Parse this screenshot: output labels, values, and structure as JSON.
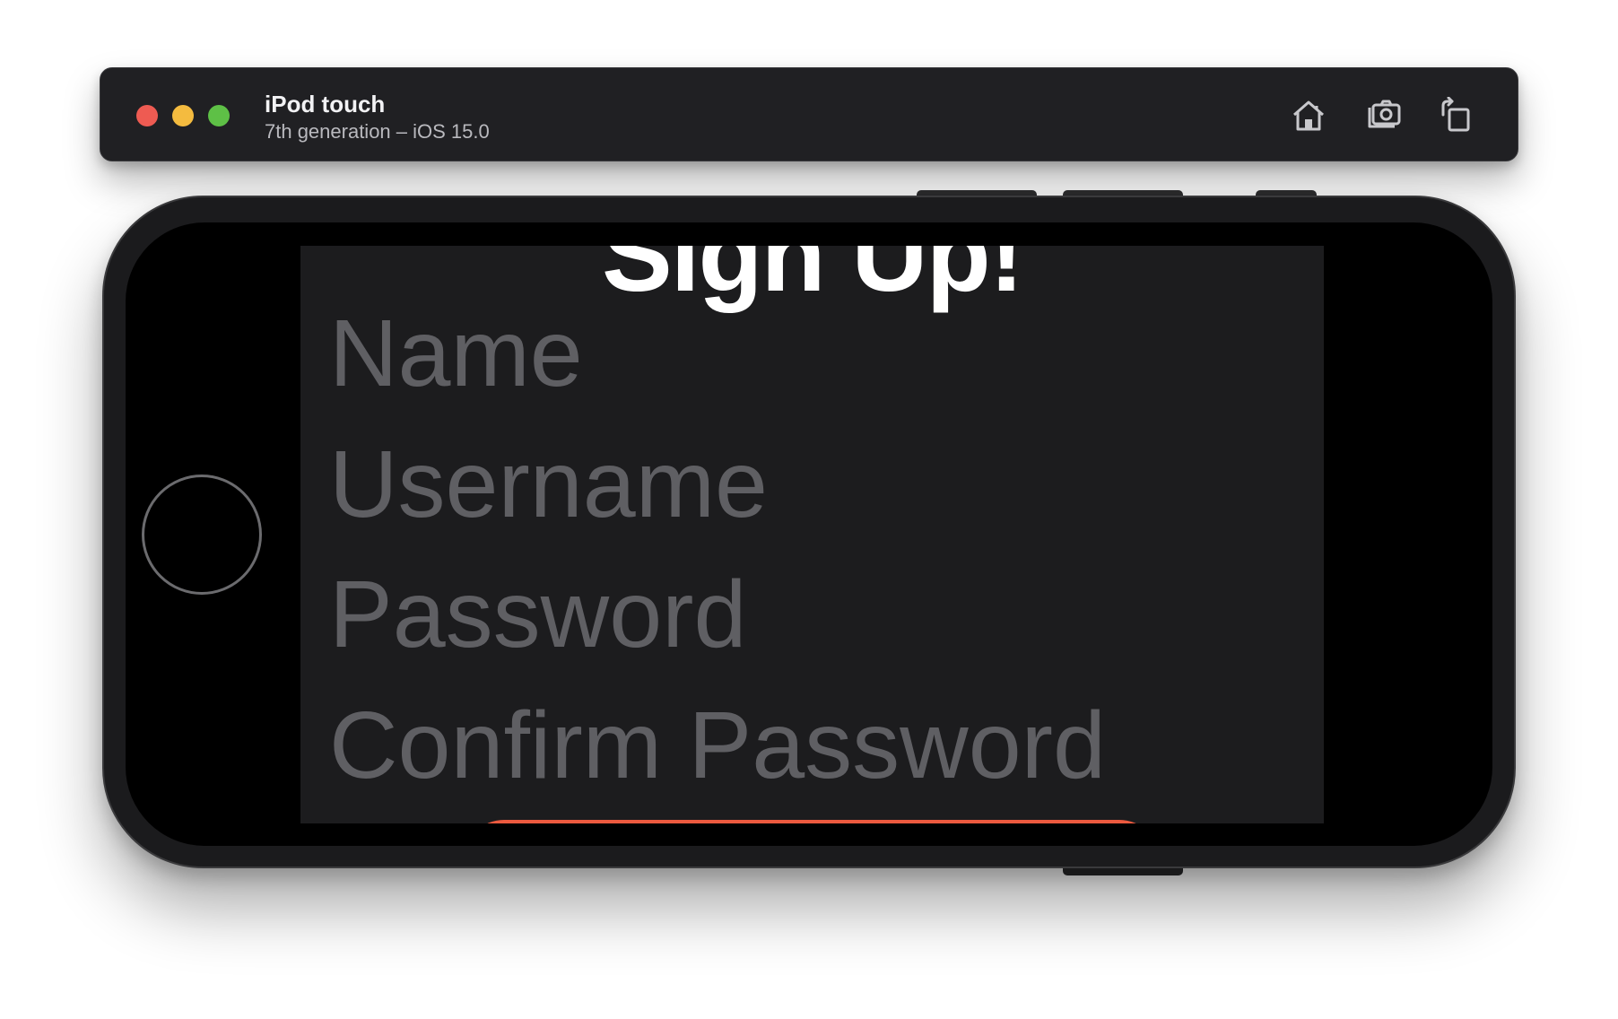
{
  "simulator": {
    "device_name": "iPod touch",
    "device_subtitle": "7th generation – iOS 15.0",
    "toolbar_icons": [
      "home-icon",
      "screenshot-icon",
      "rotate-icon"
    ]
  },
  "app": {
    "title": "Sign Up!",
    "fields": {
      "name_placeholder": "Name",
      "username_placeholder": "Username",
      "password_placeholder": "Password",
      "confirm_password_placeholder": "Confirm Password"
    },
    "colors": {
      "background": "#1c1c1e",
      "placeholder": "#5f5f63",
      "accent": "#ec5a3f"
    }
  }
}
